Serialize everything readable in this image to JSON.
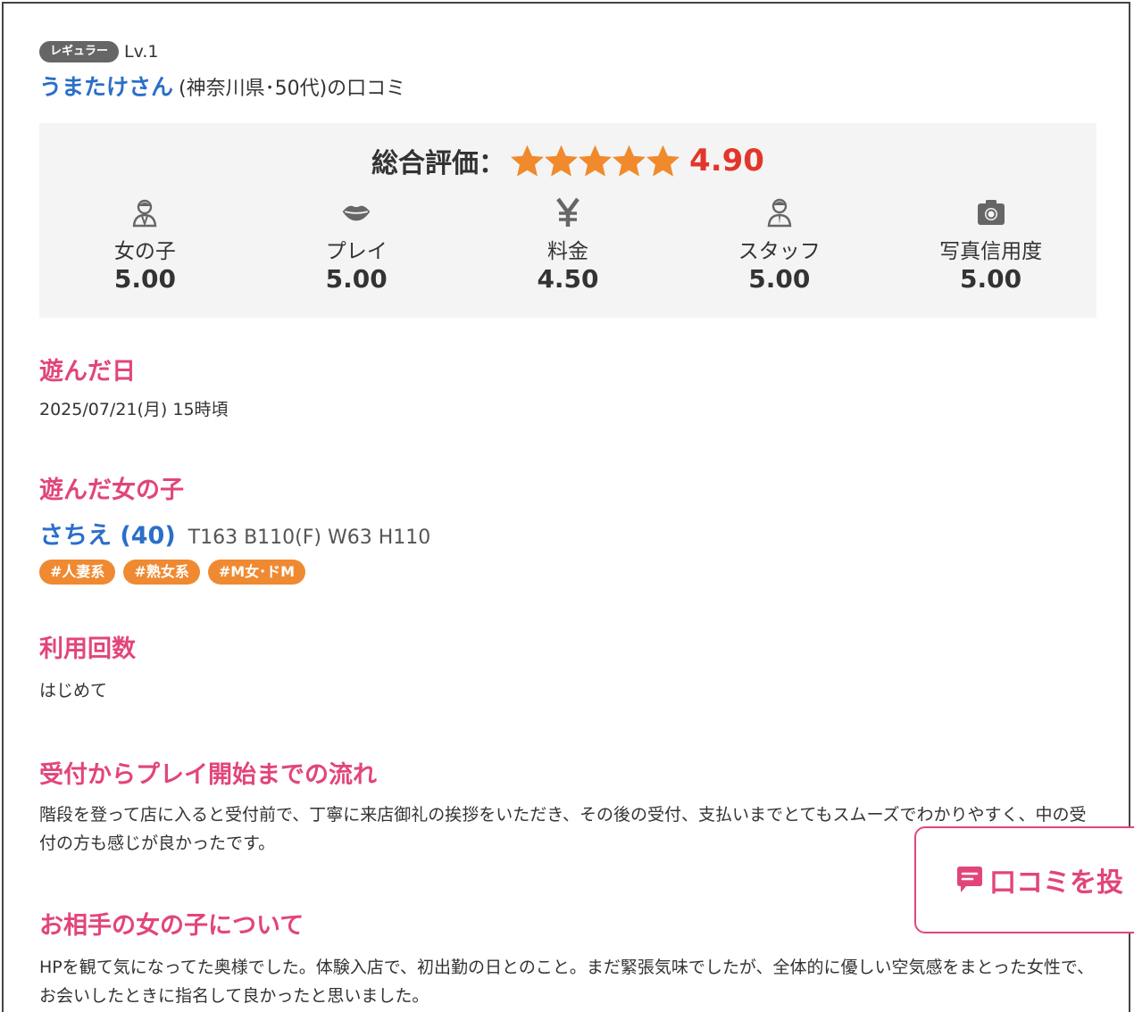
{
  "reviewer": {
    "badge": "レギュラー",
    "level": "Lv.1",
    "name": "うまたけさん",
    "info": "(神奈川県･50代)の口コミ"
  },
  "ratings": {
    "overall_label": "総合評価：",
    "overall_score": "4.90",
    "stars": 5,
    "star_color": "#f08a2c",
    "categories": [
      {
        "icon": "girl-icon",
        "label": "女の子",
        "score": "5.00"
      },
      {
        "icon": "lips-icon",
        "label": "プレイ",
        "score": "5.00"
      },
      {
        "icon": "yen-icon",
        "label": "料金",
        "score": "4.50"
      },
      {
        "icon": "staff-icon",
        "label": "スタッフ",
        "score": "5.00"
      },
      {
        "icon": "camera-icon",
        "label": "写真信用度",
        "score": "5.00"
      }
    ]
  },
  "sections": {
    "date_title": "遊んだ日",
    "date_value": "2025/07/21(月) 15時頃",
    "girl_title": "遊んだ女の子",
    "girl_name": "さちえ (40)",
    "girl_stats": "T163 B110(F) W63 H110",
    "tags": [
      "#人妻系",
      "#熟女系",
      "#M女･ドM"
    ],
    "visits_title": "利用回数",
    "visits_value": "はじめて",
    "flow_title": "受付からプレイ開始までの流れ",
    "flow_text": "階段を登って店に入ると受付前で、丁寧に来店御礼の挨拶をいただき、その後の受付、支払いまでとてもスムーズでわかりやすく、中の受付の方も感じが良かったです。",
    "about_title": "お相手の女の子について",
    "about_text": "HPを観て気になってた奥様でした。体験入店で、初出勤の日とのこと。まだ緊張気味でしたが、全体的に優しい空気感をまとった女性で、お会いしたときに指名して良かったと思いました。"
  },
  "post_button": {
    "label": "口コミを投",
    "icon": "comment-icon"
  },
  "colors": {
    "accent_pink": "#e2457a",
    "link_blue": "#2a6fc9",
    "score_red": "#e3362a",
    "tag_orange": "#ef8a32"
  }
}
